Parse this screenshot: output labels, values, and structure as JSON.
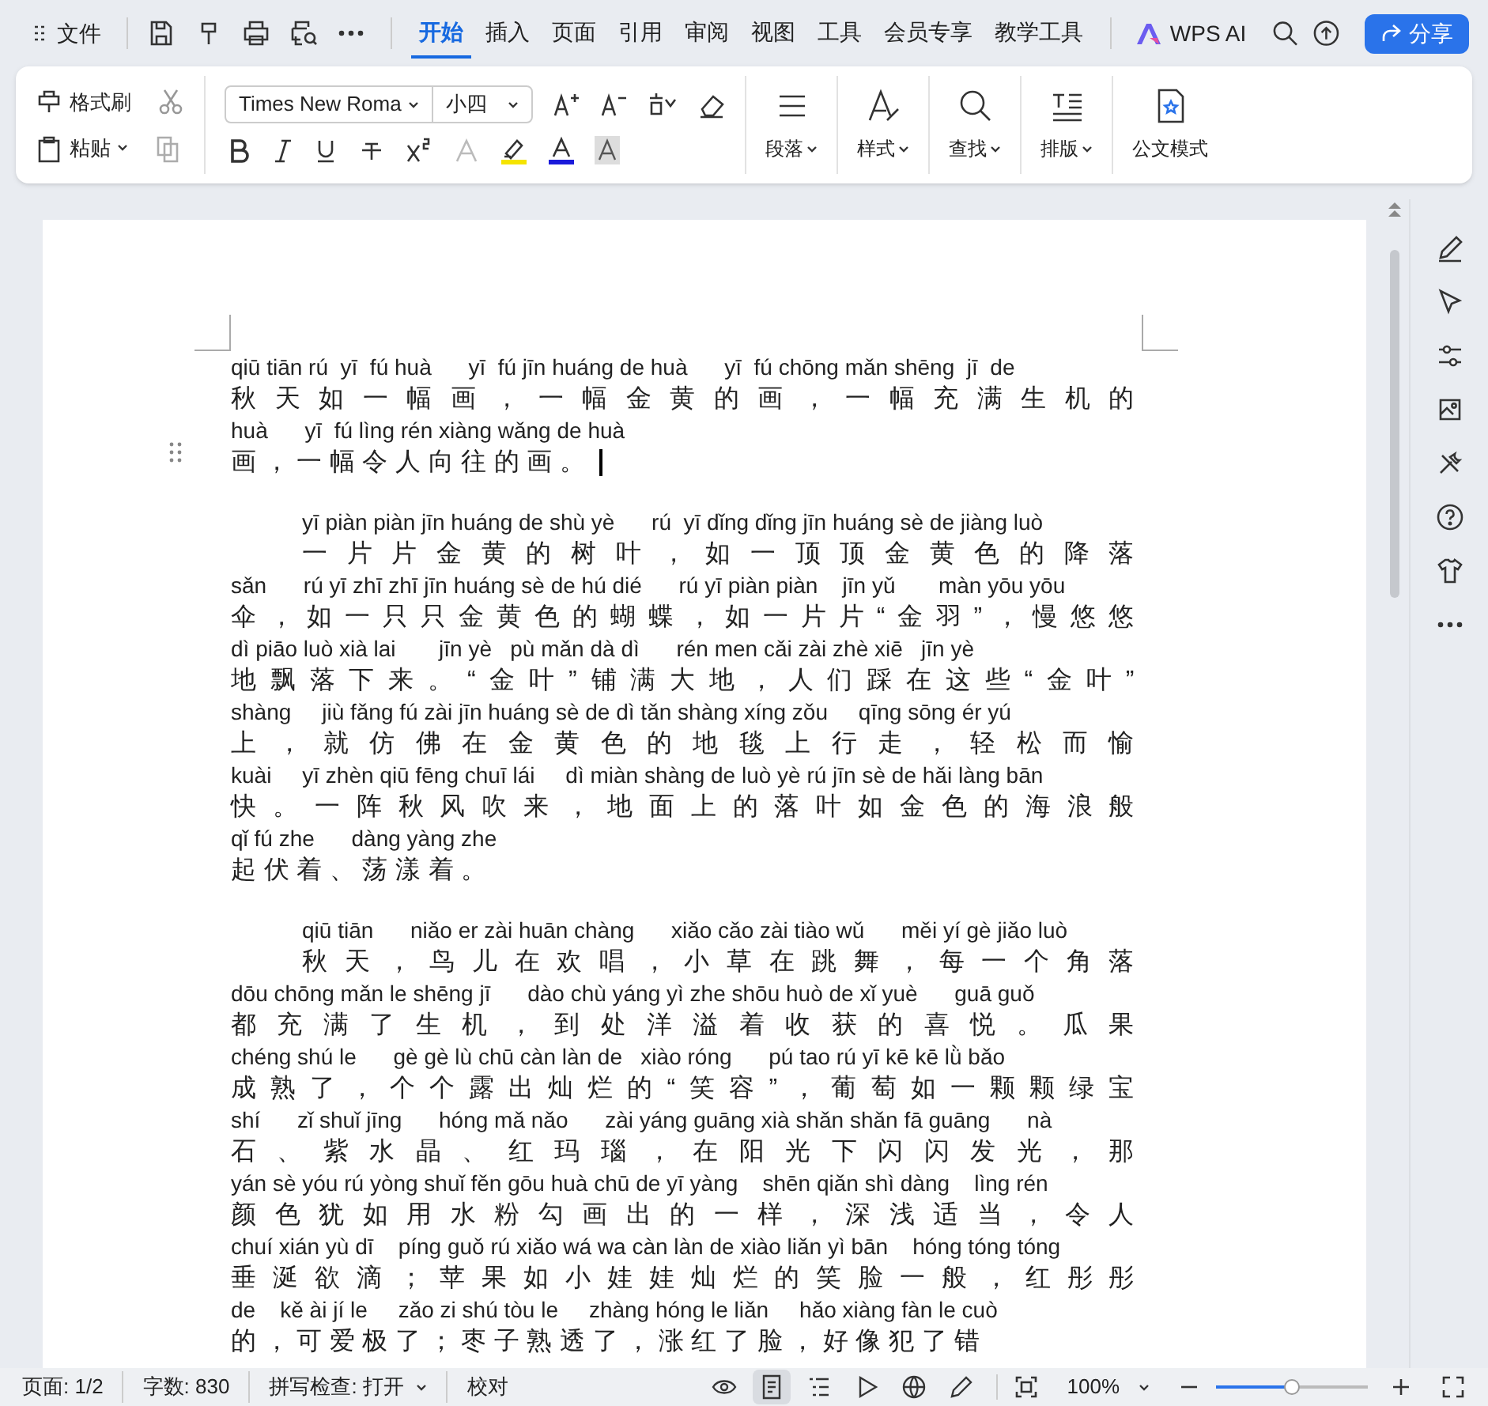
{
  "menu_bar": {
    "file_label": "文件",
    "tabs": [
      {
        "label": "开始",
        "selected": true
      },
      {
        "label": "插入",
        "selected": false
      },
      {
        "label": "页面",
        "selected": false
      },
      {
        "label": "引用",
        "selected": false
      },
      {
        "label": "审阅",
        "selected": false
      },
      {
        "label": "视图",
        "selected": false
      },
      {
        "label": "工具",
        "selected": false
      },
      {
        "label": "会员专享",
        "selected": false
      },
      {
        "label": "教学工具",
        "selected": false
      }
    ],
    "ai_label": "WPS AI",
    "share_button": "分享"
  },
  "ribbon": {
    "format_painter": "格式刷",
    "paste": "粘贴",
    "font_name": "Times New Roma",
    "font_size": "小四",
    "paragraph": "段落",
    "styles": "样式",
    "find": "查找",
    "layout": "排版",
    "official_mode": "公文模式"
  },
  "document": {
    "paragraphs": [
      {
        "indented": false,
        "lines": [
          {
            "pinyin": "qiū tiān rú  yī  fú huà      yī  fú jīn huáng de huà      yī  fú chōng mǎn shēng  jī  de",
            "hanzi": "秋天如一幅画，一幅金黄的画，一幅充满生机的"
          },
          {
            "pinyin": "huà      yī  fú lìng rén xiàng wǎng de huà",
            "hanzi": "画，一幅令人向往的画。"
          }
        ]
      },
      {
        "indented": true,
        "lines": [
          {
            "pinyin": "yī piàn piàn jīn huáng de shù yè      rú  yī dǐng dǐng jīn huáng sè de jiàng luò",
            "hanzi": "一片片金黄的树叶，如一顶顶金黄色的降落"
          },
          {
            "pinyin": "sǎn      rú yī zhī zhī jīn huáng sè de hú dié      rú yī piàn piàn    jīn yǔ       màn yōu yōu",
            "hanzi": "伞，如一只只金黄色的蝴蝶，如一片片“金羽”，慢悠悠"
          },
          {
            "pinyin": "dì piāo luò xià lai       jīn yè   pù mǎn dà dì      rén men cǎi zài zhè xiē   jīn yè",
            "hanzi": "地飘落下来。“金叶”铺满大地，人们踩在这些“金叶”"
          },
          {
            "pinyin": "shàng     jiù fǎng fú zài jīn huáng sè de dì tǎn shàng xíng zǒu     qīng sōng ér yú",
            "hanzi": "上，就仿佛在金黄色的地毯上行走，轻松而愉"
          },
          {
            "pinyin": "kuài     yī zhèn qiū fēng chuī lái     dì miàn shàng de luò yè rú jīn sè de hǎi làng bān",
            "hanzi": "快。一阵秋风吹来，地面上的落叶如金色的海浪般"
          },
          {
            "pinyin": "qǐ fú zhe      dàng yàng zhe",
            "hanzi": "起伏着、荡漾着。"
          }
        ]
      },
      {
        "indented": true,
        "lines": [
          {
            "pinyin": "qiū tiān      niǎo er zài huān chàng      xiǎo cǎo zài tiào wǔ      měi yí gè jiǎo luò",
            "hanzi": "秋天，鸟儿在欢唱，小草在跳舞，每一个角落"
          },
          {
            "pinyin": "dōu chōng mǎn le shēng jī      dào chù yáng yì zhe shōu huò de xǐ yuè      guā guǒ",
            "hanzi": "都充满了生机，到处洋溢着收获的喜悦。瓜果"
          },
          {
            "pinyin": "chéng shú le      gè gè lù chū càn làn de   xiào róng      pú tao rú yī kē kē lǜ bǎo",
            "hanzi": "成熟了，个个露出灿烂的“笑容”，葡萄如一颗颗绿宝"
          },
          {
            "pinyin": "shí      zǐ shuǐ jīng      hóng mǎ nǎo      zài yáng guāng xià shǎn shǎn fā guāng      nà",
            "hanzi": "石、紫水晶、红玛瑙，在阳光下闪闪发光，那"
          },
          {
            "pinyin": "yán sè yóu rú yòng shuǐ fěn gōu huà chū de yī yàng    shēn qiǎn shì dàng    lìng rén",
            "hanzi": "颜色犹如用水粉勾画出的一样，深浅适当，令人"
          },
          {
            "pinyin": "chuí xián yù dī    píng guǒ rú xiǎo wá wa càn làn de xiào liǎn yì bān    hóng tóng tóng",
            "hanzi": "垂涎欲滴；苹果如小娃娃灿烂的笑脸一般，红彤彤"
          },
          {
            "pinyin": "de    kě ài jí le     zǎo zi shú tòu le     zhàng hóng le liǎn     hǎo xiàng fàn le cuò",
            "hanzi": "的，可爱极了；枣子熟透了，涨红了脸，好像犯了错"
          }
        ]
      }
    ]
  },
  "status_bar": {
    "page": "页面: 1/2",
    "word_count": "字数: 830",
    "spell_check": "拼写检查: 打开",
    "proofread": "校对",
    "view_modes": [
      {
        "kind": "reading",
        "selected": false
      },
      {
        "kind": "page",
        "selected": true
      },
      {
        "kind": "outline",
        "selected": false
      },
      {
        "kind": "play",
        "selected": false
      },
      {
        "kind": "web",
        "selected": false
      },
      {
        "kind": "pen",
        "selected": false
      }
    ],
    "zoom": "100%",
    "zoom_slider": {
      "level": 0.5
    }
  }
}
